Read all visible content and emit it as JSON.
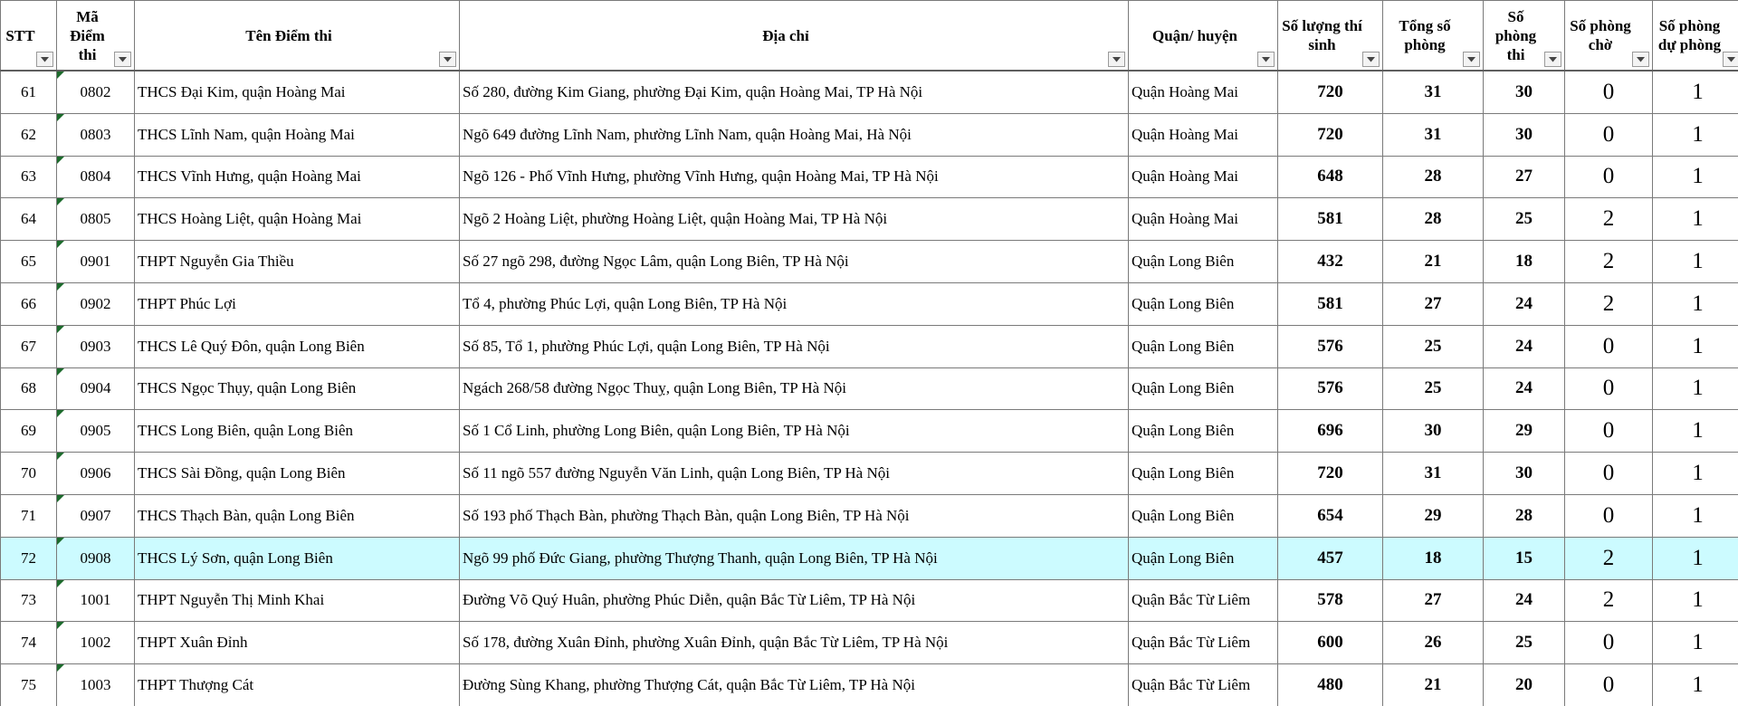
{
  "columns": [
    {
      "key": "stt",
      "label": "STT"
    },
    {
      "key": "ma",
      "label": "Mã Điểm thi"
    },
    {
      "key": "ten",
      "label": "Tên Điểm thi"
    },
    {
      "key": "diachi",
      "label": "Địa chỉ"
    },
    {
      "key": "quan",
      "label": "Quận/ huyện"
    },
    {
      "key": "soluong",
      "label": "Số lượng thí sinh"
    },
    {
      "key": "tongphong",
      "label": "Tổng số phòng"
    },
    {
      "key": "phongthi",
      "label": "Số phòng thi"
    },
    {
      "key": "phongcho",
      "label": "Số phòng chờ"
    },
    {
      "key": "duphong",
      "label": "Số phòng dự phòng"
    }
  ],
  "rows": [
    {
      "stt": "61",
      "ma": "0802",
      "ten": "THCS Đại Kim, quận Hoàng Mai",
      "diachi": "Số 280, đường Kim Giang, phường Đại Kim, quận Hoàng Mai, TP Hà Nội",
      "quan": "Quận Hoàng Mai",
      "soluong": "720",
      "tongphong": "31",
      "phongthi": "30",
      "phongcho": "0",
      "duphong": "1"
    },
    {
      "stt": "62",
      "ma": "0803",
      "ten": "THCS Lĩnh Nam, quận Hoàng Mai",
      "diachi": "Ngõ 649 đường Lĩnh Nam, phường Lĩnh Nam, quận Hoàng Mai, Hà Nội",
      "quan": "Quận Hoàng Mai",
      "soluong": "720",
      "tongphong": "31",
      "phongthi": "30",
      "phongcho": "0",
      "duphong": "1"
    },
    {
      "stt": "63",
      "ma": "0804",
      "ten": "THCS Vĩnh Hưng, quận Hoàng Mai",
      "diachi": "Ngõ 126 - Phố Vĩnh Hưng, phường Vĩnh Hưng, quận Hoàng Mai, TP Hà Nội",
      "quan": "Quận Hoàng Mai",
      "soluong": "648",
      "tongphong": "28",
      "phongthi": "27",
      "phongcho": "0",
      "duphong": "1"
    },
    {
      "stt": "64",
      "ma": "0805",
      "ten": "THCS Hoàng Liệt, quận Hoàng Mai",
      "diachi": "Ngõ 2 Hoàng Liệt, phường Hoàng Liệt, quận Hoàng Mai, TP Hà Nội",
      "quan": "Quận Hoàng Mai",
      "soluong": "581",
      "tongphong": "28",
      "phongthi": "25",
      "phongcho": "2",
      "duphong": "1"
    },
    {
      "stt": "65",
      "ma": "0901",
      "ten": "THPT Nguyễn Gia Thiều",
      "diachi": "Số 27 ngõ 298, đường Ngọc Lâm, quận Long Biên, TP Hà Nội",
      "quan": "Quận Long Biên",
      "soluong": "432",
      "tongphong": "21",
      "phongthi": "18",
      "phongcho": "2",
      "duphong": "1"
    },
    {
      "stt": "66",
      "ma": "0902",
      "ten": "THPT Phúc Lợi",
      "diachi": "Tổ 4, phường Phúc Lợi, quận Long Biên, TP Hà Nội",
      "quan": "Quận Long Biên",
      "soluong": "581",
      "tongphong": "27",
      "phongthi": "24",
      "phongcho": "2",
      "duphong": "1"
    },
    {
      "stt": "67",
      "ma": "0903",
      "ten": "THCS Lê Quý Đôn, quận Long Biên",
      "diachi": "Số 85, Tổ 1, phường Phúc Lợi, quận Long Biên, TP Hà Nội",
      "quan": "Quận Long Biên",
      "soluong": "576",
      "tongphong": "25",
      "phongthi": "24",
      "phongcho": "0",
      "duphong": "1"
    },
    {
      "stt": "68",
      "ma": "0904",
      "ten": "THCS Ngọc Thụy, quận Long Biên",
      "diachi": "Ngách 268/58 đường Ngọc Thuỵ, quận Long Biên, TP Hà Nội",
      "quan": "Quận Long Biên",
      "soluong": "576",
      "tongphong": "25",
      "phongthi": "24",
      "phongcho": "0",
      "duphong": "1"
    },
    {
      "stt": "69",
      "ma": "0905",
      "ten": "THCS Long Biên, quận Long Biên",
      "diachi": "Số 1 Cổ Linh, phường Long Biên, quận Long Biên, TP Hà Nội",
      "quan": "Quận Long Biên",
      "soluong": "696",
      "tongphong": "30",
      "phongthi": "29",
      "phongcho": "0",
      "duphong": "1"
    },
    {
      "stt": "70",
      "ma": "0906",
      "ten": "THCS Sài Đồng, quận Long Biên",
      "diachi": "Số 11 ngõ 557 đường Nguyễn Văn Linh, quận Long Biên, TP Hà Nội",
      "quan": "Quận Long Biên",
      "soluong": "720",
      "tongphong": "31",
      "phongthi": "30",
      "phongcho": "0",
      "duphong": "1"
    },
    {
      "stt": "71",
      "ma": "0907",
      "ten": "THCS Thạch Bàn, quận Long Biên",
      "diachi": "Số 193 phố Thạch Bàn, phường Thạch Bàn, quận Long Biên, TP Hà Nội",
      "quan": "Quận Long Biên",
      "soluong": "654",
      "tongphong": "29",
      "phongthi": "28",
      "phongcho": "0",
      "duphong": "1"
    },
    {
      "stt": "72",
      "ma": "0908",
      "ten": "THCS Lý Sơn, quận Long Biên",
      "diachi": "Ngõ 99 phố Đức Giang, phường Thượng Thanh, quận Long Biên, TP Hà Nội",
      "quan": "Quận Long Biên",
      "soluong": "457",
      "tongphong": "18",
      "phongthi": "15",
      "phongcho": "2",
      "duphong": "1"
    },
    {
      "stt": "73",
      "ma": "1001",
      "ten": "THPT Nguyễn Thị Minh Khai",
      "diachi": "Đường Võ Quý Huân, phường Phúc Diễn, quận Bắc Từ Liêm, TP Hà Nội",
      "quan": "Quận Bắc Từ Liêm",
      "soluong": "578",
      "tongphong": "27",
      "phongthi": "24",
      "phongcho": "2",
      "duphong": "1"
    },
    {
      "stt": "74",
      "ma": "1002",
      "ten": "THPT Xuân Đỉnh",
      "diachi": "Số 178, đường Xuân Đỉnh, phường Xuân Đỉnh, quận Bắc Từ Liêm, TP Hà Nội",
      "quan": "Quận Bắc Từ Liêm",
      "soluong": "600",
      "tongphong": "26",
      "phongthi": "25",
      "phongcho": "0",
      "duphong": "1"
    },
    {
      "stt": "75",
      "ma": "1003",
      "ten": "THPT Thượng Cát",
      "diachi": "Đường Sùng Khang, phường Thượng Cát, quận Bắc Từ Liêm, TP Hà Nội",
      "quan": "Quận Bắc Từ Liêm",
      "soluong": "480",
      "tongphong": "21",
      "phongthi": "20",
      "phongcho": "0",
      "duphong": "1"
    }
  ],
  "selected_row": "72",
  "colors": {
    "selection": "#ccfbff",
    "comment_marker": "#1c6b2c",
    "gridline": "#7a7a7a"
  },
  "icons": {
    "filter": "dropdown-arrow-icon",
    "cell_marker": "comment-triangle-icon"
  }
}
